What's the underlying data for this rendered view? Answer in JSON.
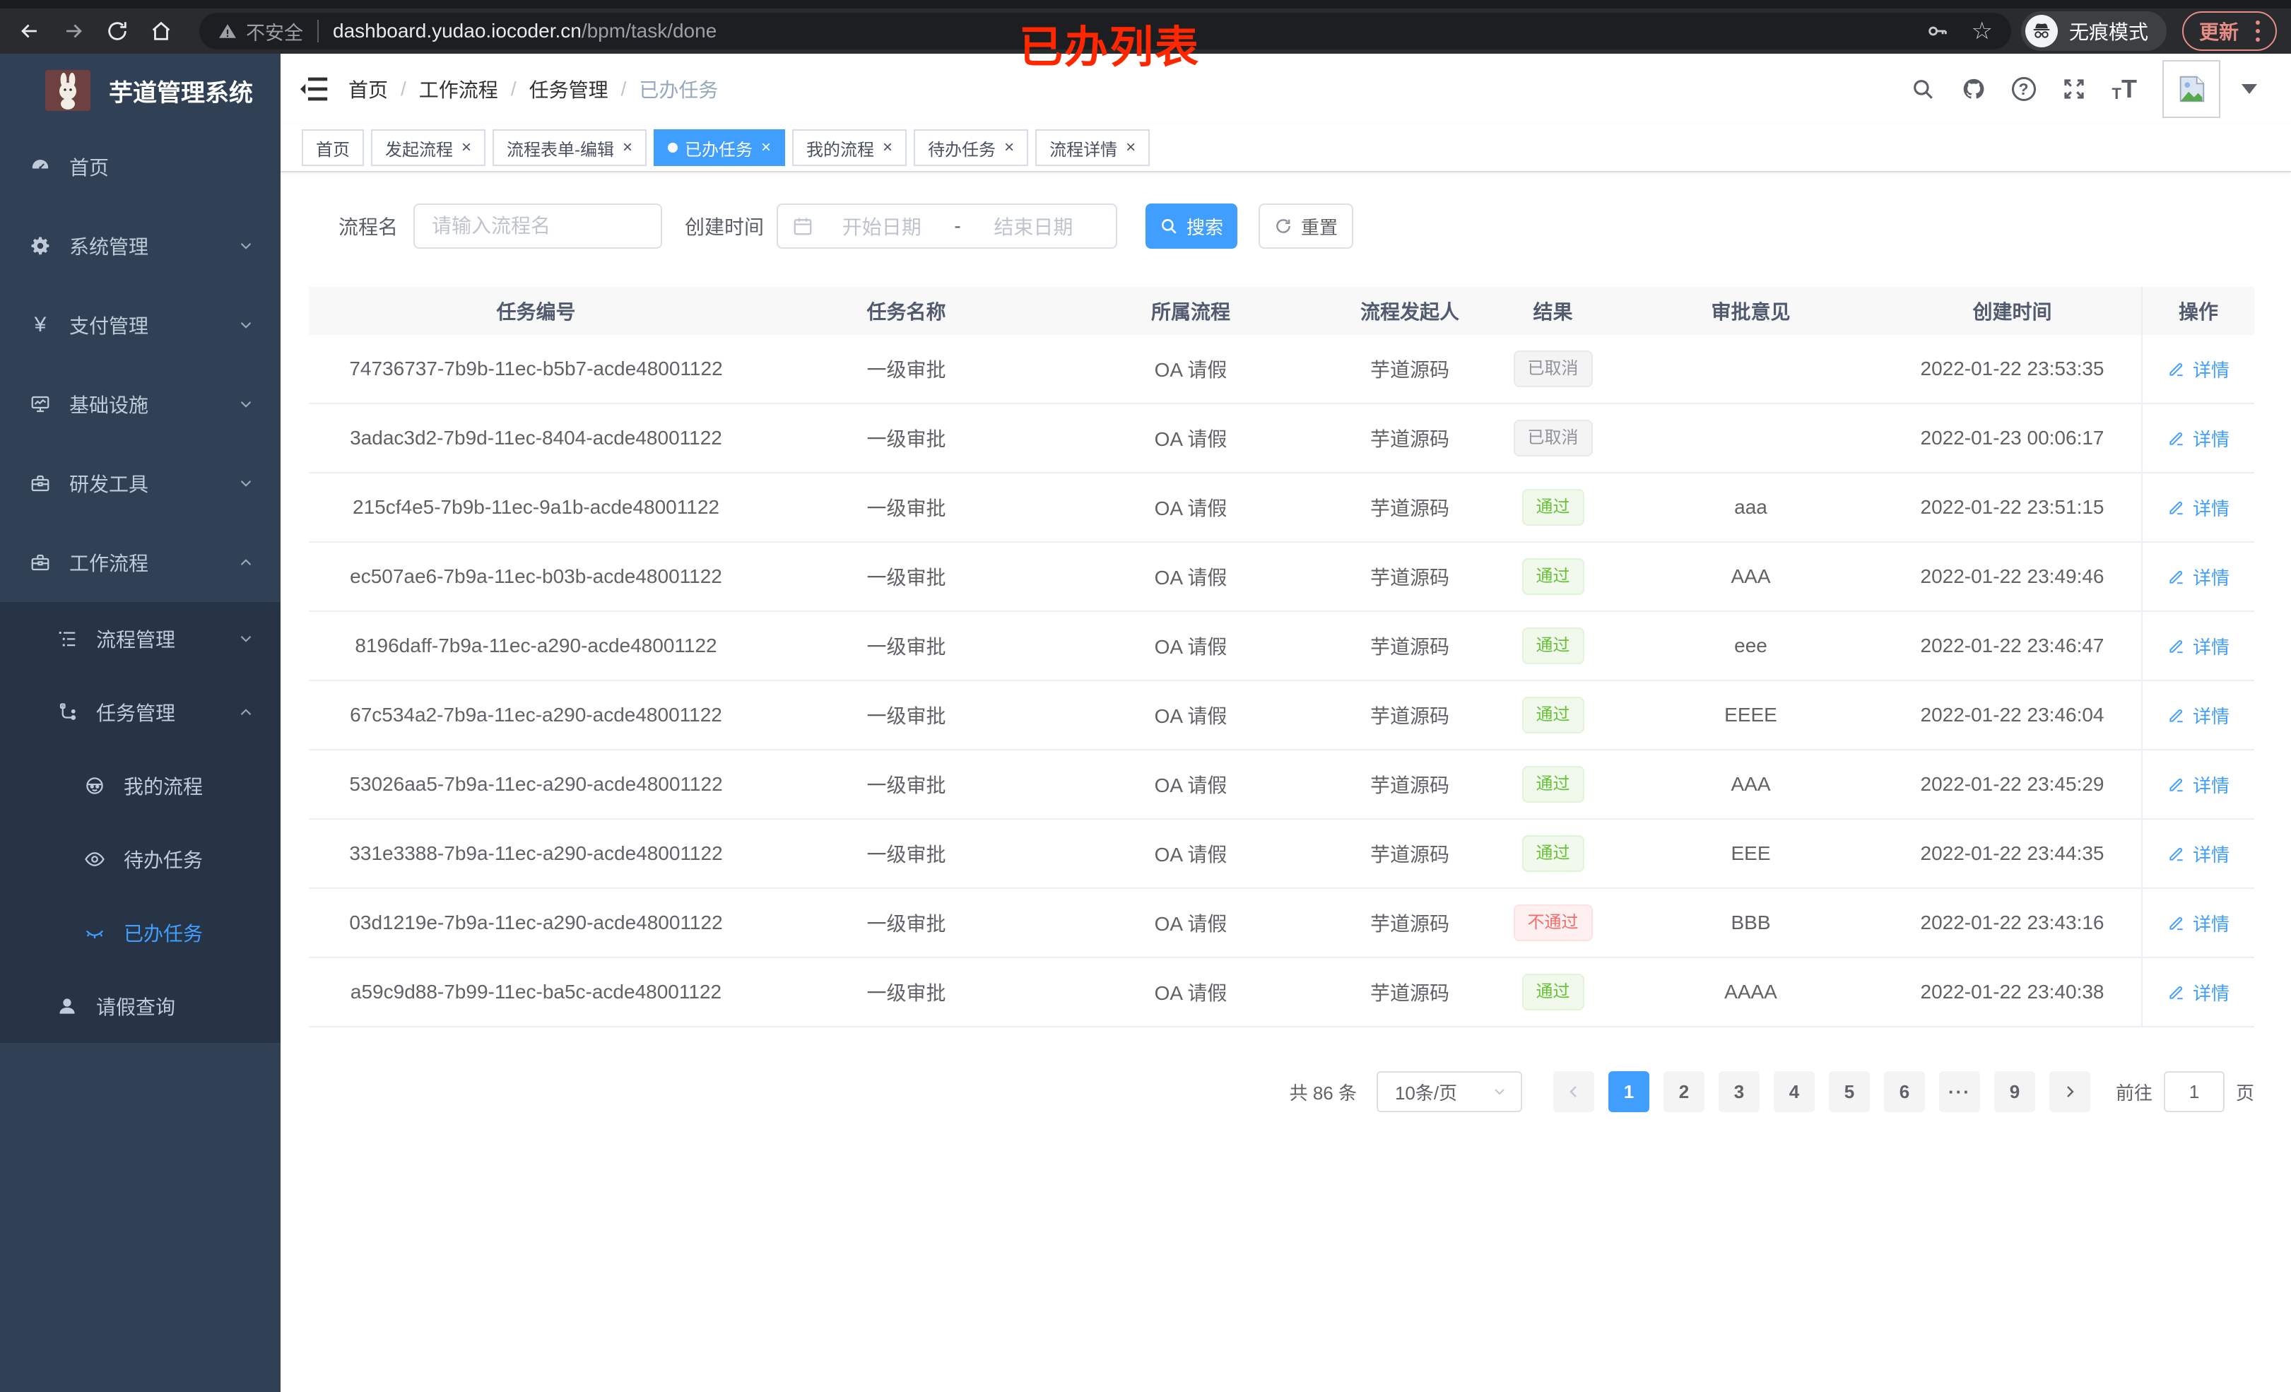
{
  "browser": {
    "security_label": "不安全",
    "url_host": "dashboard.yudao.iocoder.cn",
    "url_path": "/bpm/task/done",
    "incognito_label": "无痕模式",
    "update_label": "更新",
    "overlay_title": "已办列表"
  },
  "icons": {
    "star": "☆",
    "close": "×",
    "yen": "¥",
    "question": "?",
    "font_small": "T",
    "font_big": "T"
  },
  "sidebar": {
    "logo_title": "芋道管理系统",
    "items": [
      {
        "label": "首页",
        "icon": "dashboard-icon",
        "depth": 1
      },
      {
        "label": "系统管理",
        "icon": "gear-icon",
        "depth": 1,
        "chevron": "down"
      },
      {
        "label": "支付管理",
        "icon": "yen-icon",
        "depth": 1,
        "chevron": "down"
      },
      {
        "label": "基础设施",
        "icon": "monitor-icon",
        "depth": 1,
        "chevron": "down"
      },
      {
        "label": "研发工具",
        "icon": "toolbox-icon",
        "depth": 1,
        "chevron": "down"
      },
      {
        "label": "工作流程",
        "icon": "toolbox-icon",
        "depth": 1,
        "chevron": "up",
        "expanded": true
      },
      {
        "label": "流程管理",
        "icon": "tree-icon",
        "depth": 2,
        "chevron": "down"
      },
      {
        "label": "任务管理",
        "icon": "flow-icon",
        "depth": 2,
        "chevron": "up",
        "expanded": true
      },
      {
        "label": "我的流程",
        "icon": "robot-icon",
        "depth": 3
      },
      {
        "label": "待办任务",
        "icon": "eye-icon",
        "depth": 3
      },
      {
        "label": "已办任务",
        "icon": "eye-closed-icon",
        "depth": 3,
        "active": true
      },
      {
        "label": "请假查询",
        "icon": "user-icon",
        "depth": 2
      }
    ]
  },
  "breadcrumb": {
    "separator": "/",
    "items": [
      "首页",
      "工作流程",
      "任务管理",
      "已办任务"
    ]
  },
  "tabs": [
    {
      "label": "首页",
      "closable": false,
      "active": false
    },
    {
      "label": "发起流程",
      "closable": true,
      "active": false
    },
    {
      "label": "流程表单-编辑",
      "closable": true,
      "active": false
    },
    {
      "label": "已办任务",
      "closable": true,
      "active": true
    },
    {
      "label": "我的流程",
      "closable": true,
      "active": false
    },
    {
      "label": "待办任务",
      "closable": true,
      "active": false
    },
    {
      "label": "流程详情",
      "closable": true,
      "active": false
    }
  ],
  "filters": {
    "name_label": "流程名",
    "name_placeholder": "请输入流程名",
    "time_label": "创建时间",
    "start_placeholder": "开始日期",
    "range_separator": "-",
    "end_placeholder": "结束日期",
    "search_label": "搜索",
    "reset_label": "重置"
  },
  "table": {
    "columns": [
      "任务编号",
      "任务名称",
      "所属流程",
      "流程发起人",
      "结果",
      "审批意见",
      "创建时间",
      "操作"
    ],
    "detail_label": "详情",
    "rows": [
      {
        "id": "74736737-7b9b-11ec-b5b7-acde48001122",
        "name": "一级审批",
        "process": "OA 请假",
        "starter": "芋道源码",
        "result": "已取消",
        "result_type": "info",
        "comment": "",
        "time": "2022-01-22 23:53:35"
      },
      {
        "id": "3adac3d2-7b9d-11ec-8404-acde48001122",
        "name": "一级审批",
        "process": "OA 请假",
        "starter": "芋道源码",
        "result": "已取消",
        "result_type": "info",
        "comment": "",
        "time": "2022-01-23 00:06:17"
      },
      {
        "id": "215cf4e5-7b9b-11ec-9a1b-acde48001122",
        "name": "一级审批",
        "process": "OA 请假",
        "starter": "芋道源码",
        "result": "通过",
        "result_type": "success",
        "comment": "aaa",
        "time": "2022-01-22 23:51:15"
      },
      {
        "id": "ec507ae6-7b9a-11ec-b03b-acde48001122",
        "name": "一级审批",
        "process": "OA 请假",
        "starter": "芋道源码",
        "result": "通过",
        "result_type": "success",
        "comment": "AAA",
        "time": "2022-01-22 23:49:46"
      },
      {
        "id": "8196daff-7b9a-11ec-a290-acde48001122",
        "name": "一级审批",
        "process": "OA 请假",
        "starter": "芋道源码",
        "result": "通过",
        "result_type": "success",
        "comment": "eee",
        "time": "2022-01-22 23:46:47"
      },
      {
        "id": "67c534a2-7b9a-11ec-a290-acde48001122",
        "name": "一级审批",
        "process": "OA 请假",
        "starter": "芋道源码",
        "result": "通过",
        "result_type": "success",
        "comment": "EEEE",
        "time": "2022-01-22 23:46:04"
      },
      {
        "id": "53026aa5-7b9a-11ec-a290-acde48001122",
        "name": "一级审批",
        "process": "OA 请假",
        "starter": "芋道源码",
        "result": "通过",
        "result_type": "success",
        "comment": "AAA",
        "time": "2022-01-22 23:45:29"
      },
      {
        "id": "331e3388-7b9a-11ec-a290-acde48001122",
        "name": "一级审批",
        "process": "OA 请假",
        "starter": "芋道源码",
        "result": "通过",
        "result_type": "success",
        "comment": "EEE",
        "time": "2022-01-22 23:44:35"
      },
      {
        "id": "03d1219e-7b9a-11ec-a290-acde48001122",
        "name": "一级审批",
        "process": "OA 请假",
        "starter": "芋道源码",
        "result": "不通过",
        "result_type": "danger",
        "comment": "BBB",
        "time": "2022-01-22 23:43:16"
      },
      {
        "id": "a59c9d88-7b99-11ec-ba5c-acde48001122",
        "name": "一级审批",
        "process": "OA 请假",
        "starter": "芋道源码",
        "result": "通过",
        "result_type": "success",
        "comment": "AAAA",
        "time": "2022-01-22 23:40:38"
      }
    ]
  },
  "pagination": {
    "total_label": "共 86 条",
    "page_size": "10条/页",
    "pages": [
      "1",
      "2",
      "3",
      "4",
      "5",
      "6",
      "···",
      "9"
    ],
    "active_page": "1",
    "goto_label": "前往",
    "goto_value": "1",
    "page_unit": "页"
  },
  "colors": {
    "accent": "#409eff",
    "sidebar_bg": "#304156",
    "submenu_bg": "#263445",
    "success_text": "#67c23a",
    "success_bg": "#f0f9eb",
    "danger_text": "#f56c6c",
    "danger_bg": "#fef0f0",
    "info_text": "#909399",
    "info_bg": "#f4f4f5",
    "overlay_red": "#ff2600"
  }
}
